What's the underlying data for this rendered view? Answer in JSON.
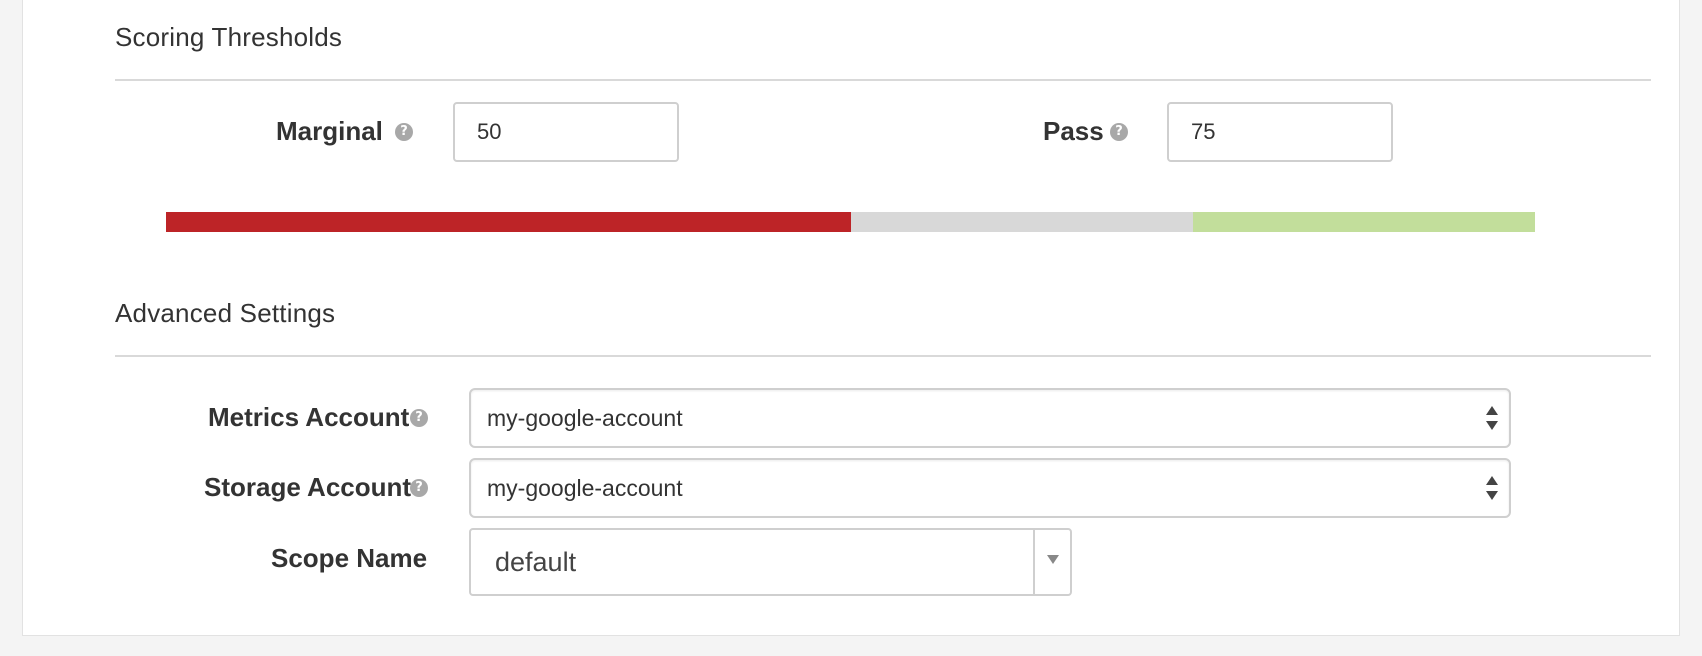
{
  "scoring": {
    "title": "Scoring Thresholds",
    "marginal_label": "Marginal",
    "marginal_value": "50",
    "pass_label": "Pass",
    "pass_value": "75"
  },
  "threshold_bar": {
    "marginal_percent": 50,
    "pass_percent": 75,
    "colors": {
      "fail": "#bd2427",
      "marginal": "#d8d8d8",
      "pass": "#c2de9b"
    }
  },
  "advanced": {
    "title": "Advanced Settings",
    "metrics_account_label": "Metrics Account",
    "metrics_account_value": "my-google-account",
    "storage_account_label": "Storage Account",
    "storage_account_value": "my-google-account",
    "scope_name_label": "Scope Name",
    "scope_name_value": "default"
  },
  "icons": {
    "help": "question-circle-icon",
    "select_arrows": "up-down-arrows-icon",
    "dropdown": "caret-down-icon"
  }
}
